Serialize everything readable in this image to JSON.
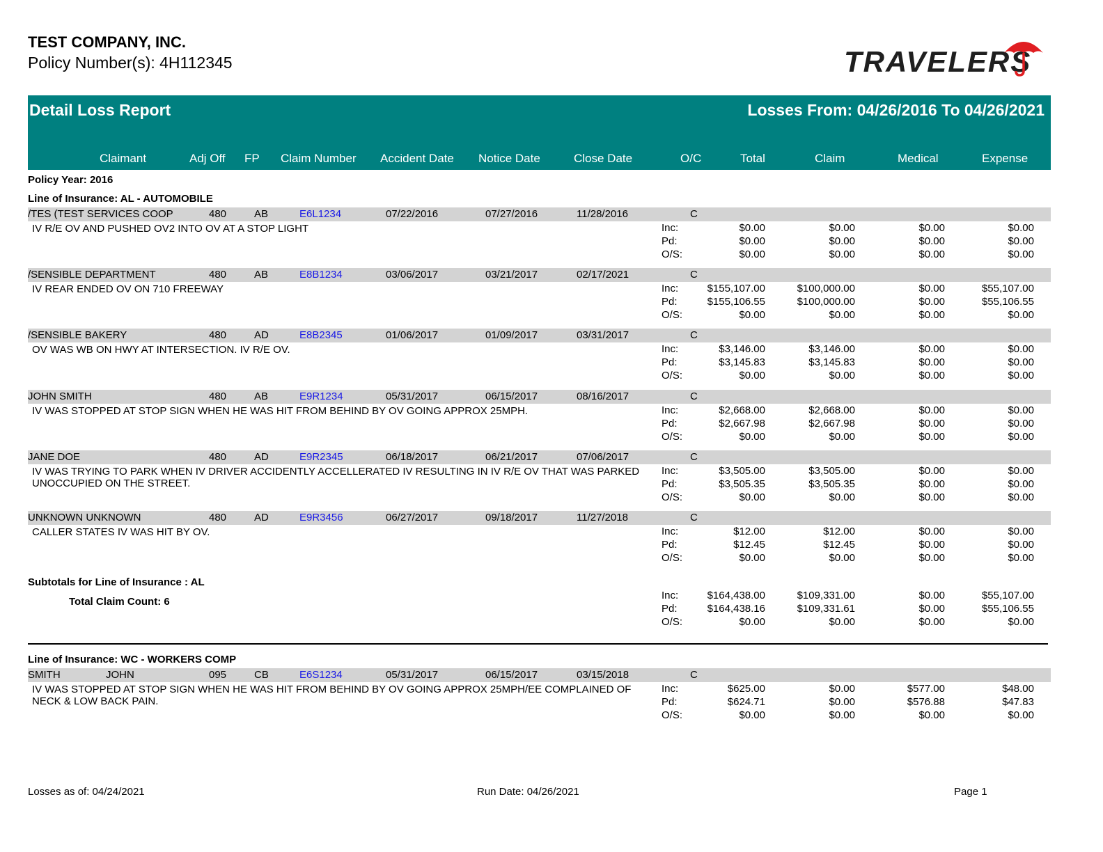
{
  "header": {
    "company": "TEST COMPANY, INC.",
    "policy": "Policy Number(s): 4H112345",
    "logo_text": "TRAVELERS",
    "report_title": "Detail Loss Report",
    "report_range": "Losses From: 04/26/2016 To 04/26/2021"
  },
  "colors": {
    "band": "#008080",
    "row_band": "#d3d3d3",
    "link": "#1a1ae6",
    "umbrella": "#e01e22"
  },
  "columns": [
    "Claimant",
    "Adj Off",
    "FP",
    "Claim Number",
    "Accident Date",
    "Notice Date",
    "Close Date",
    "O/C",
    "Total",
    "Claim",
    "Medical",
    "Expense"
  ],
  "policy_year": "Policy Year: 2016",
  "labels": {
    "inc": "Inc:",
    "pd": "Pd:",
    "os": "O/S:"
  },
  "sections": [
    {
      "line": "Line of Insurance: AL - AUTOMOBILE",
      "claims": [
        {
          "claimant": "/TES (TEST SERVICES COOP",
          "adj": "480",
          "fp": "AB",
          "number": "E6L1234",
          "accident": "07/22/2016",
          "notice": "07/27/2016",
          "close": "11/28/2016",
          "oc": "C",
          "desc": "IV R/E OV AND PUSHED OV2 INTO OV AT A STOP LIGHT",
          "inc": [
            "$0.00",
            "$0.00",
            "$0.00",
            "$0.00"
          ],
          "pd": [
            "$0.00",
            "$0.00",
            "$0.00",
            "$0.00"
          ],
          "os": [
            "$0.00",
            "$0.00",
            "$0.00",
            "$0.00"
          ]
        },
        {
          "claimant": "/SENSIBLE DEPARTMENT",
          "adj": "480",
          "fp": "AB",
          "number": "E8B1234",
          "accident": "03/06/2017",
          "notice": "03/21/2017",
          "close": "02/17/2021",
          "oc": "C",
          "desc": "IV REAR ENDED OV ON 710 FREEWAY",
          "inc": [
            "$155,107.00",
            "$100,000.00",
            "$0.00",
            "$55,107.00"
          ],
          "pd": [
            "$155,106.55",
            "$100,000.00",
            "$0.00",
            "$55,106.55"
          ],
          "os": [
            "$0.00",
            "$0.00",
            "$0.00",
            "$0.00"
          ]
        },
        {
          "claimant": "/SENSIBLE BAKERY",
          "adj": "480",
          "fp": "AD",
          "number": "E8B2345",
          "accident": "01/06/2017",
          "notice": "01/09/2017",
          "close": "03/31/2017",
          "oc": "C",
          "desc": "OV WAS WB ON HWY AT INTERSECTION. IV R/E OV.",
          "inc": [
            "$3,146.00",
            "$3,146.00",
            "$0.00",
            "$0.00"
          ],
          "pd": [
            "$3,145.83",
            "$3,145.83",
            "$0.00",
            "$0.00"
          ],
          "os": [
            "$0.00",
            "$0.00",
            "$0.00",
            "$0.00"
          ]
        },
        {
          "claimant": "JOHN SMITH",
          "adj": "480",
          "fp": "AB",
          "number": "E9R1234",
          "accident": "05/31/2017",
          "notice": "06/15/2017",
          "close": "08/16/2017",
          "oc": "C",
          "desc": "IV WAS STOPPED AT STOP SIGN WHEN HE WAS HIT FROM BEHIND BY OV GOING APPROX 25MPH.",
          "inc": [
            "$2,668.00",
            "$2,668.00",
            "$0.00",
            "$0.00"
          ],
          "pd": [
            "$2,667.98",
            "$2,667.98",
            "$0.00",
            "$0.00"
          ],
          "os": [
            "$0.00",
            "$0.00",
            "$0.00",
            "$0.00"
          ]
        },
        {
          "claimant": "JANE DOE",
          "adj": "480",
          "fp": "AD",
          "number": "E9R2345",
          "accident": "06/18/2017",
          "notice": "06/21/2017",
          "close": "07/06/2017",
          "oc": "C",
          "desc": "IV WAS TRYING TO PARK WHEN IV DRIVER ACCIDENTLY ACCELLERATED IV RESULTING  IN IV  R/E OV THAT WAS PARKED UNOCCUPIED ON THE STREET.",
          "inc": [
            "$3,505.00",
            "$3,505.00",
            "$0.00",
            "$0.00"
          ],
          "pd": [
            "$3,505.35",
            "$3,505.35",
            "$0.00",
            "$0.00"
          ],
          "os": [
            "$0.00",
            "$0.00",
            "$0.00",
            "$0.00"
          ]
        },
        {
          "claimant": "UNKNOWN UNKNOWN",
          "adj": "480",
          "fp": "AD",
          "number": "E9R3456",
          "accident": "06/27/2017",
          "notice": "09/18/2017",
          "close": "11/27/2018",
          "oc": "C",
          "desc": "CALLER STATES IV WAS HIT BY OV.",
          "inc": [
            "$12.00",
            "$12.00",
            "$0.00",
            "$0.00"
          ],
          "pd": [
            "$12.45",
            "$12.45",
            "$0.00",
            "$0.00"
          ],
          "os": [
            "$0.00",
            "$0.00",
            "$0.00",
            "$0.00"
          ]
        }
      ],
      "subtotal": {
        "title": "Subtotals for Line of Insurance : AL",
        "count": "Total Claim Count: 6",
        "inc": [
          "$164,438.00",
          "$109,331.00",
          "$0.00",
          "$55,107.00"
        ],
        "pd": [
          "$164,438.16",
          "$109,331.61",
          "$0.00",
          "$55,106.55"
        ],
        "os": [
          "$0.00",
          "$0.00",
          "$0.00",
          "$0.00"
        ]
      }
    },
    {
      "line": "Line of Insurance: WC - WORKERS COMP",
      "claims": [
        {
          "claimant": "SMITH",
          "claimant2": "JOHN",
          "adj": "095",
          "fp": "CB",
          "number": "E6S1234",
          "accident": "05/31/2017",
          "notice": "06/15/2017",
          "close": "03/15/2018",
          "oc": "C",
          "desc": "IV WAS STOPPED AT STOP SIGN WHEN HE WAS HIT FROM BEHIND BY OV GOING APPROX 25MPH/EE COMPLAINED OF NECK & LOW BACK PAIN.",
          "inc": [
            "$625.00",
            "$0.00",
            "$577.00",
            "$48.00"
          ],
          "pd": [
            "$624.71",
            "$0.00",
            "$576.88",
            "$47.83"
          ],
          "os": [
            "$0.00",
            "$0.00",
            "$0.00",
            "$0.00"
          ]
        }
      ]
    }
  ],
  "footer": {
    "losses_as_of": "Losses as of: 04/24/2021",
    "run_date": "Run Date: 04/26/2021",
    "page": "Page 1"
  }
}
